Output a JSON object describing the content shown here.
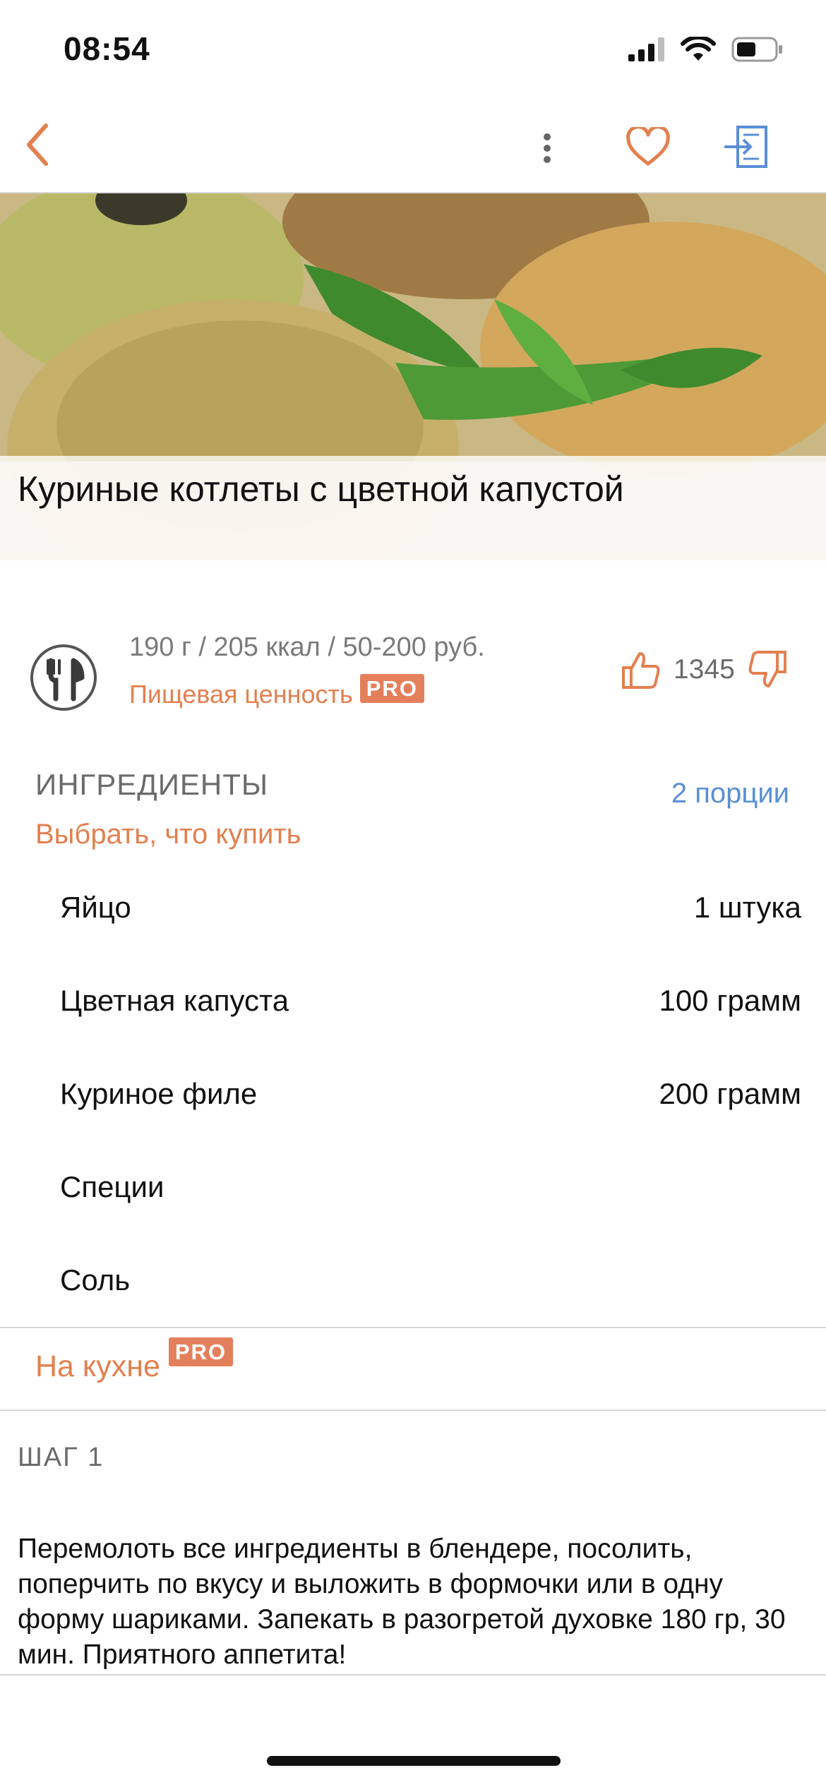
{
  "status_bar": {
    "time": "08:54"
  },
  "recipe": {
    "title": "Куриные котлеты с цветной капустой",
    "meta": "190 г / 205 ккал / 50-200 руб.",
    "nutrition_link": "Пищевая ценность",
    "pro_badge": "PRO",
    "rating_count": "1345"
  },
  "ingredients": {
    "heading": "ИНГРЕДИЕНТЫ",
    "portions": "2 порции",
    "choose_to_buy": "Выбрать, что купить",
    "items": [
      {
        "name": "Яйцо",
        "amount": "1 штука"
      },
      {
        "name": "Цветная капуста",
        "amount": "100 грамм"
      },
      {
        "name": "Куриное филе",
        "amount": "200 грамм"
      },
      {
        "name": "Специи",
        "amount": ""
      },
      {
        "name": "Соль",
        "amount": ""
      }
    ]
  },
  "kitchen": {
    "label": "На кухне",
    "pro_badge": "PRO"
  },
  "steps": [
    {
      "heading": "ШАГ 1",
      "text": "Перемолоть все ингредиенты в блендере, посолить, поперчить по вкусу и выложить в формочки или в одну форму шариками. Запекать в разогретой духовке 180 гр, 30 мин. Приятного аппетита!"
    }
  ],
  "colors": {
    "accent": "#e3804f",
    "link_blue": "#5a8fd6",
    "pro_bg": "#e3805b"
  },
  "icons": [
    "back-arrow-icon",
    "more-vertical-icon",
    "heart-icon",
    "login-icon",
    "cutlery-icon",
    "thumbs-up-icon",
    "thumbs-down-icon",
    "signal-icon",
    "wifi-icon",
    "battery-icon"
  ]
}
